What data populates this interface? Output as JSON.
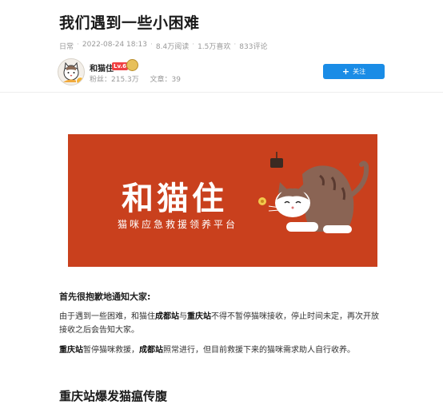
{
  "article": {
    "title": "我们遇到一些小困难",
    "category": "日常",
    "datetime": "2022-08-24 18:13",
    "reads": "8.4万阅读",
    "likes": "1.5万喜欢",
    "comments": "833评论"
  },
  "author": {
    "name": "和猫住",
    "level_badge": "Lv.6",
    "followers": "粉丝：215.3万",
    "articles": "文章：39",
    "follow_label": "关注"
  },
  "banner": {
    "title": "和猫住",
    "subtitle": "猫咪应急救援领养平台",
    "background": "#c9401d"
  },
  "body": {
    "intro_heading": "首先很抱歉地通知大家:",
    "p1_before": "由于遇到一些困难，和猫住",
    "p1_bold1": "成都站",
    "p1_mid": "与",
    "p1_bold2": "重庆站",
    "p1_after": "不得不暂停猫咪接收，停止时间未定，再次开放接收之后会告知大家。",
    "p2_bold1": "重庆站",
    "p2_mid1": "暂停猫咪救援，",
    "p2_bold2": "成都站",
    "p2_after": "照常进行，但目前救援下来的猫咪需求助人自行收养。",
    "section_heading": "重庆站爆发猫瘟传腹"
  },
  "colors": {
    "accent": "#1a8ce6",
    "banner": "#c9401d"
  }
}
